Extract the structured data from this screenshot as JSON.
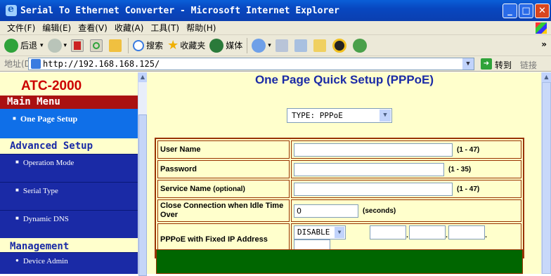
{
  "window": {
    "title": "Serial To Ethernet Converter - Microsoft Internet Explorer"
  },
  "menubar": [
    "文件(F)",
    "编辑(E)",
    "查看(V)",
    "收藏(A)",
    "工具(T)",
    "帮助(H)"
  ],
  "toolbar": {
    "back": "后退",
    "search": "搜索",
    "favorites": "收藏夹",
    "media": "媒体"
  },
  "address": {
    "label": "地址(D)",
    "url": "http://192.168.168.125/",
    "go": "转到",
    "links": "链接"
  },
  "sidebar": {
    "logo": "ATC-2000",
    "main_menu": "Main Menu",
    "one_page": "One Page Setup",
    "advanced": "Advanced Setup",
    "items": [
      "Operation Mode",
      "Serial Type",
      "Dynamic DNS"
    ],
    "management": "Management",
    "mgmt_items": [
      "Device Admin"
    ]
  },
  "main": {
    "title": "One Page Quick Setup (PPPoE)",
    "type_select": "TYPE: PPPoE",
    "rows": {
      "user_name": {
        "label": "User Name",
        "hint": "(1 - 47)"
      },
      "password": {
        "label": "Password",
        "hint": "(1 - 35)"
      },
      "service_name": {
        "label": "Service Name",
        "sub": "(optional)",
        "hint": "(1 - 47)"
      },
      "idle": {
        "label": "Close Connection when Idle Time Over",
        "value": "0",
        "hint": "(seconds)"
      },
      "fixed_ip": {
        "label": "PPPoE with Fixed IP Address",
        "select": "DISABLE"
      }
    }
  },
  "colors": {
    "accent": "#1a2aa6",
    "menu_red": "#aa1111",
    "highlight": "#0f6fe8",
    "page_bg": "#ffffcc",
    "border": "#993300",
    "green": "#006600"
  }
}
